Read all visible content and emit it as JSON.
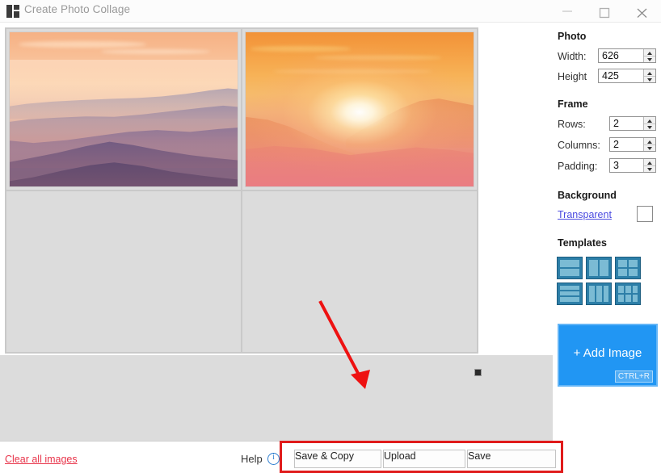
{
  "window": {
    "title": "Create Photo Collage",
    "icon": "collage-grid-icon",
    "controls": {
      "minimize": "–",
      "maximize": "□",
      "close": "✕"
    }
  },
  "canvas": {
    "grid": {
      "rows": 2,
      "columns": 2,
      "filled_cells": 2,
      "empty_cells": 2
    },
    "cells": [
      {
        "index": 0,
        "state": "filled",
        "image": "sunset-mountain-ridges"
      },
      {
        "index": 1,
        "state": "filled",
        "image": "sunset-sun-over-hills"
      },
      {
        "index": 2,
        "state": "empty",
        "image": ""
      },
      {
        "index": 3,
        "state": "empty",
        "image": ""
      }
    ],
    "resize_handle": "bottom-right-resize-handle"
  },
  "panel": {
    "photo": {
      "heading": "Photo",
      "fields": [
        {
          "label": "Width:",
          "value": "626"
        },
        {
          "label": "Height",
          "value": "425"
        }
      ]
    },
    "frame": {
      "heading": "Frame",
      "fields": [
        {
          "label": "Rows:",
          "value": "2"
        },
        {
          "label": "Columns:",
          "value": "2"
        },
        {
          "label": "Padding:",
          "value": "3"
        }
      ]
    },
    "background": {
      "heading": "Background",
      "link_label": "Transparent",
      "swatch_color": "#ffffff"
    },
    "templates": {
      "heading": "Templates",
      "items": [
        {
          "name": "template-2-rows",
          "layout": "2x1"
        },
        {
          "name": "template-2-columns",
          "layout": "1x2"
        },
        {
          "name": "template-2x2-grid",
          "layout": "2x2"
        },
        {
          "name": "template-3-rows",
          "layout": "3x1"
        },
        {
          "name": "template-3-columns",
          "layout": "1x3"
        },
        {
          "name": "template-3x2-grid",
          "layout": "3x2"
        }
      ]
    },
    "add_image": {
      "label": "+ Add Image",
      "shortcut": "CTRL+R",
      "color": "#2196f3"
    }
  },
  "bottom": {
    "clear_link": "Clear all images",
    "clear_color": "#e8344a",
    "help_label": "Help",
    "help_icon": "info-icon",
    "buttons": [
      {
        "name": "save-and-copy-button",
        "label": "Save & Copy"
      },
      {
        "name": "upload-button",
        "label": "Upload"
      },
      {
        "name": "save-button",
        "label": "Save"
      }
    ]
  },
  "annotations": {
    "highlight_color": "#e01b1b",
    "rectangle_target": "bottom-action-buttons",
    "arrow_target": "bottom-action-buttons"
  }
}
